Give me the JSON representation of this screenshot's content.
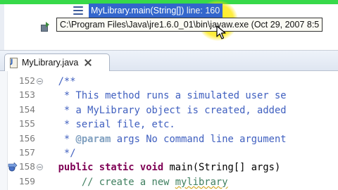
{
  "debug": {
    "frame_method": "MyLibrary.main(String[])",
    "frame_line": "line: 160",
    "process_label": "C:\\Program Files\\Java\\jre1.6.0_01\\bin\\javaw.exe (Oct 29, 2007 8:5",
    "icons": {
      "stack_frame": "stack-frame-icon",
      "process": "process-icon",
      "cursor": "mouse-pointer-icon"
    },
    "highlight_color": "#ffe600",
    "bar_color": "#37d94a"
  },
  "editor": {
    "tab": {
      "label": "MyLibrary.java",
      "icon": "java-file-icon",
      "close_icon": "close-icon"
    },
    "lines": [
      {
        "number": "152",
        "fold": true,
        "marker": "",
        "segments": [
          {
            "t": "  /**",
            "c": "comment"
          }
        ]
      },
      {
        "number": "153",
        "fold": false,
        "marker": "",
        "segments": [
          {
            "t": "   * This method runs a simulated user se",
            "c": "comment"
          }
        ]
      },
      {
        "number": "154",
        "fold": false,
        "marker": "",
        "segments": [
          {
            "t": "   * a MyLibrary object is created, added",
            "c": "comment"
          }
        ]
      },
      {
        "number": "155",
        "fold": false,
        "marker": "",
        "segments": [
          {
            "t": "   * serial file, etc.",
            "c": "comment"
          }
        ]
      },
      {
        "number": "156",
        "fold": false,
        "marker": "",
        "segments": [
          {
            "t": "   * ",
            "c": "comment"
          },
          {
            "t": "@param",
            "c": "tag"
          },
          {
            "t": " args No command line argument",
            "c": "comment"
          }
        ]
      },
      {
        "number": "157",
        "fold": false,
        "marker": "",
        "segments": [
          {
            "t": "   */",
            "c": "comment"
          }
        ]
      },
      {
        "number": "158",
        "fold": true,
        "marker": "breakpoint-arrow-icon",
        "segments": [
          {
            "t": "  ",
            "c": "plain"
          },
          {
            "t": "public static void",
            "c": "kw"
          },
          {
            "t": " main(String[] args)",
            "c": "plain"
          }
        ]
      },
      {
        "number": "159",
        "fold": false,
        "marker": "",
        "segments": [
          {
            "t": "      // create a new ",
            "c": "inline"
          },
          {
            "t": "mylibrary",
            "c": "inline-squiggle"
          }
        ]
      }
    ],
    "colors": {
      "comment": "#3f5fbf",
      "keyword": "#7f0055",
      "inline_comment": "#3f7f5f"
    }
  }
}
